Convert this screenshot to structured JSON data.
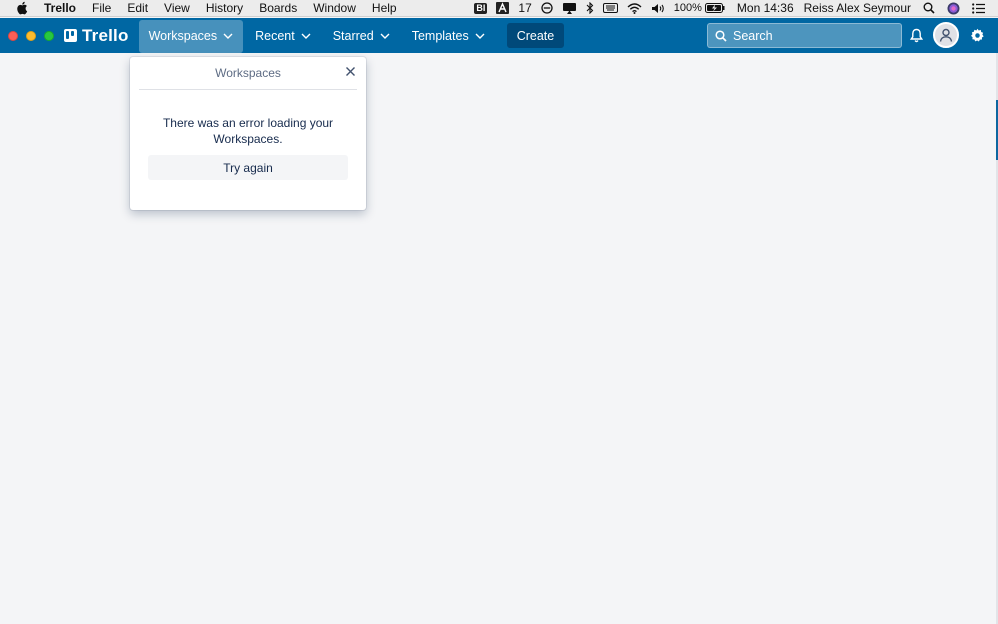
{
  "menubar": {
    "app_name": "Trello",
    "items": [
      "File",
      "Edit",
      "View",
      "History",
      "Boards",
      "Window",
      "Help"
    ],
    "status": {
      "badge": "BI",
      "number": "17",
      "battery": "100%",
      "clock": "Mon 14:36",
      "user": "Reiss Alex Seymour"
    }
  },
  "header": {
    "logo": "Trello",
    "nav": {
      "workspaces": "Workspaces",
      "recent": "Recent",
      "starred": "Starred",
      "templates": "Templates"
    },
    "create_label": "Create",
    "search_placeholder": "Search"
  },
  "popover": {
    "title": "Workspaces",
    "message": "There was an error loading your Workspaces.",
    "retry_label": "Try again"
  },
  "colors": {
    "header": "#0067a3",
    "create": "#00497a",
    "background": "#f4f5f7"
  }
}
